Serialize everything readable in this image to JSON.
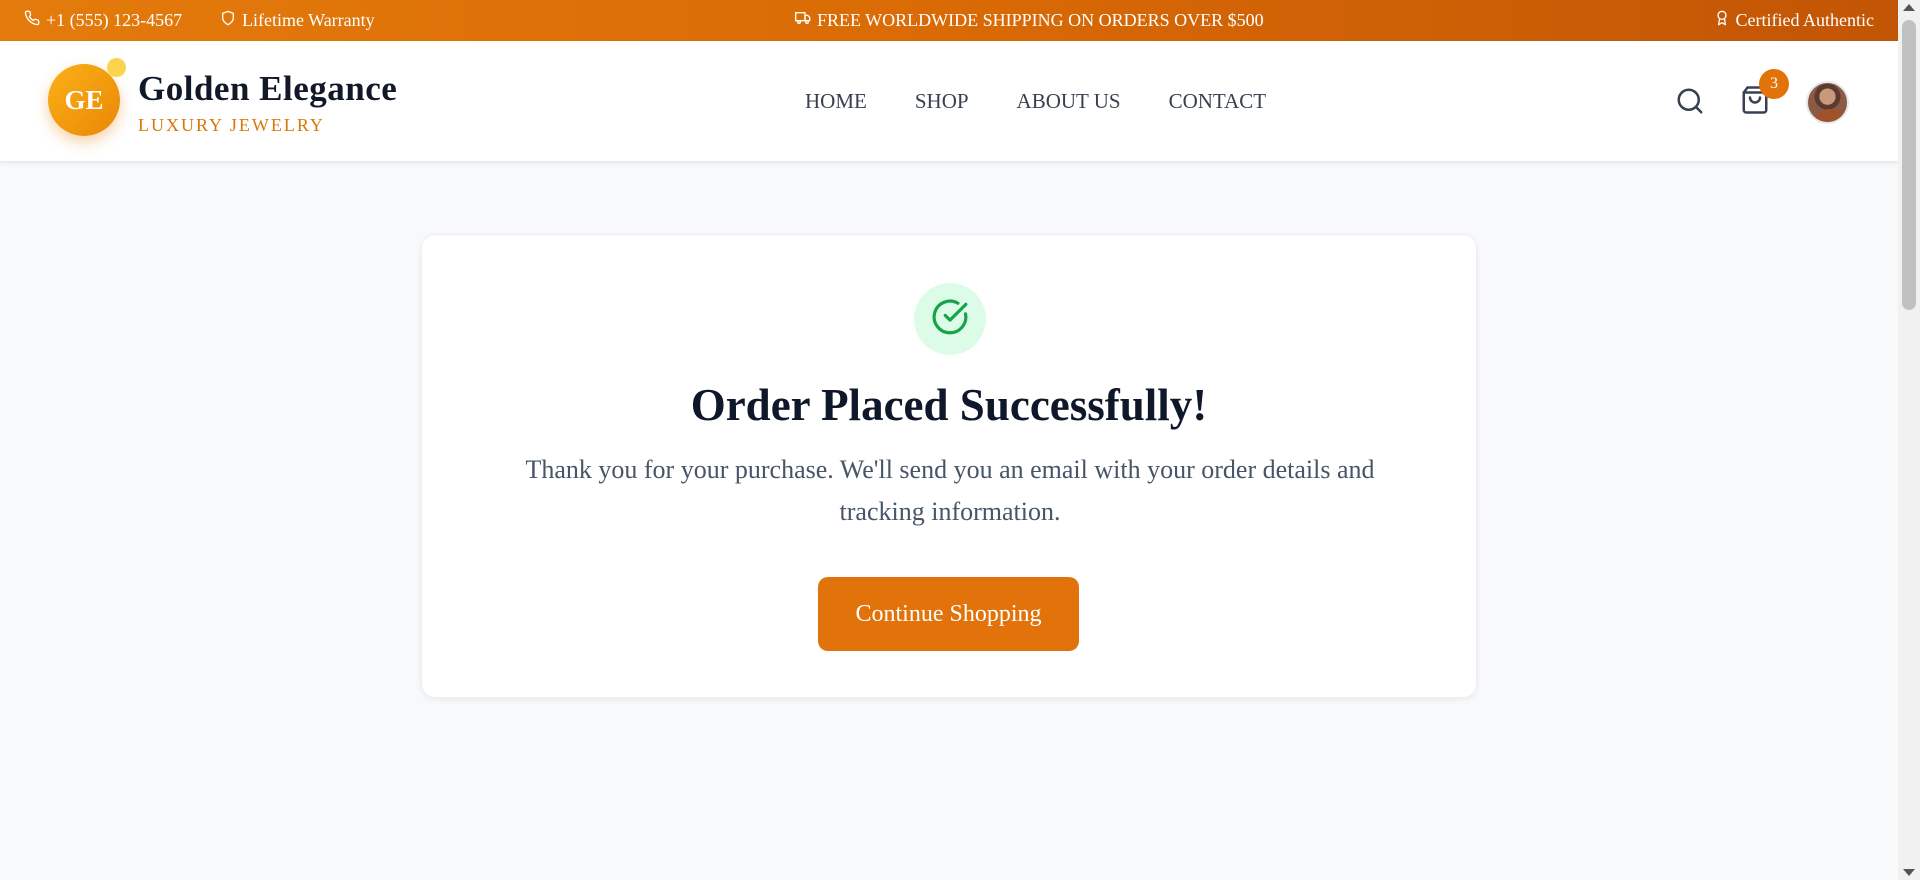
{
  "topbar": {
    "phone": "+1 (555) 123-4567",
    "warranty": "Lifetime Warranty",
    "shipping": "FREE WORLDWIDE SHIPPING ON ORDERS OVER $500",
    "authentic": "Certified Authentic",
    "icons": [
      "phone-icon",
      "shield-icon",
      "truck-icon",
      "award-icon"
    ]
  },
  "brand": {
    "initials": "GE",
    "name": "Golden Elegance",
    "tagline": "LUXURY JEWELRY"
  },
  "nav": {
    "items": [
      {
        "label": "HOME"
      },
      {
        "label": "SHOP"
      },
      {
        "label": "ABOUT US"
      },
      {
        "label": "CONTACT"
      }
    ]
  },
  "header_actions": {
    "cart_count": "3",
    "icons": [
      "search-icon",
      "shopping-bag-icon",
      "avatar"
    ]
  },
  "confirmation": {
    "title": "Order Placed Successfully!",
    "message": "Thank you for your purchase. We'll send you an email with your order details and tracking information.",
    "button_label": "Continue Shopping",
    "icon": "check-circle-icon"
  },
  "colors": {
    "accent": "#e2720a",
    "brand_gold": "#f29a0c",
    "success_bg": "#dcfce7",
    "success": "#16a34a"
  }
}
